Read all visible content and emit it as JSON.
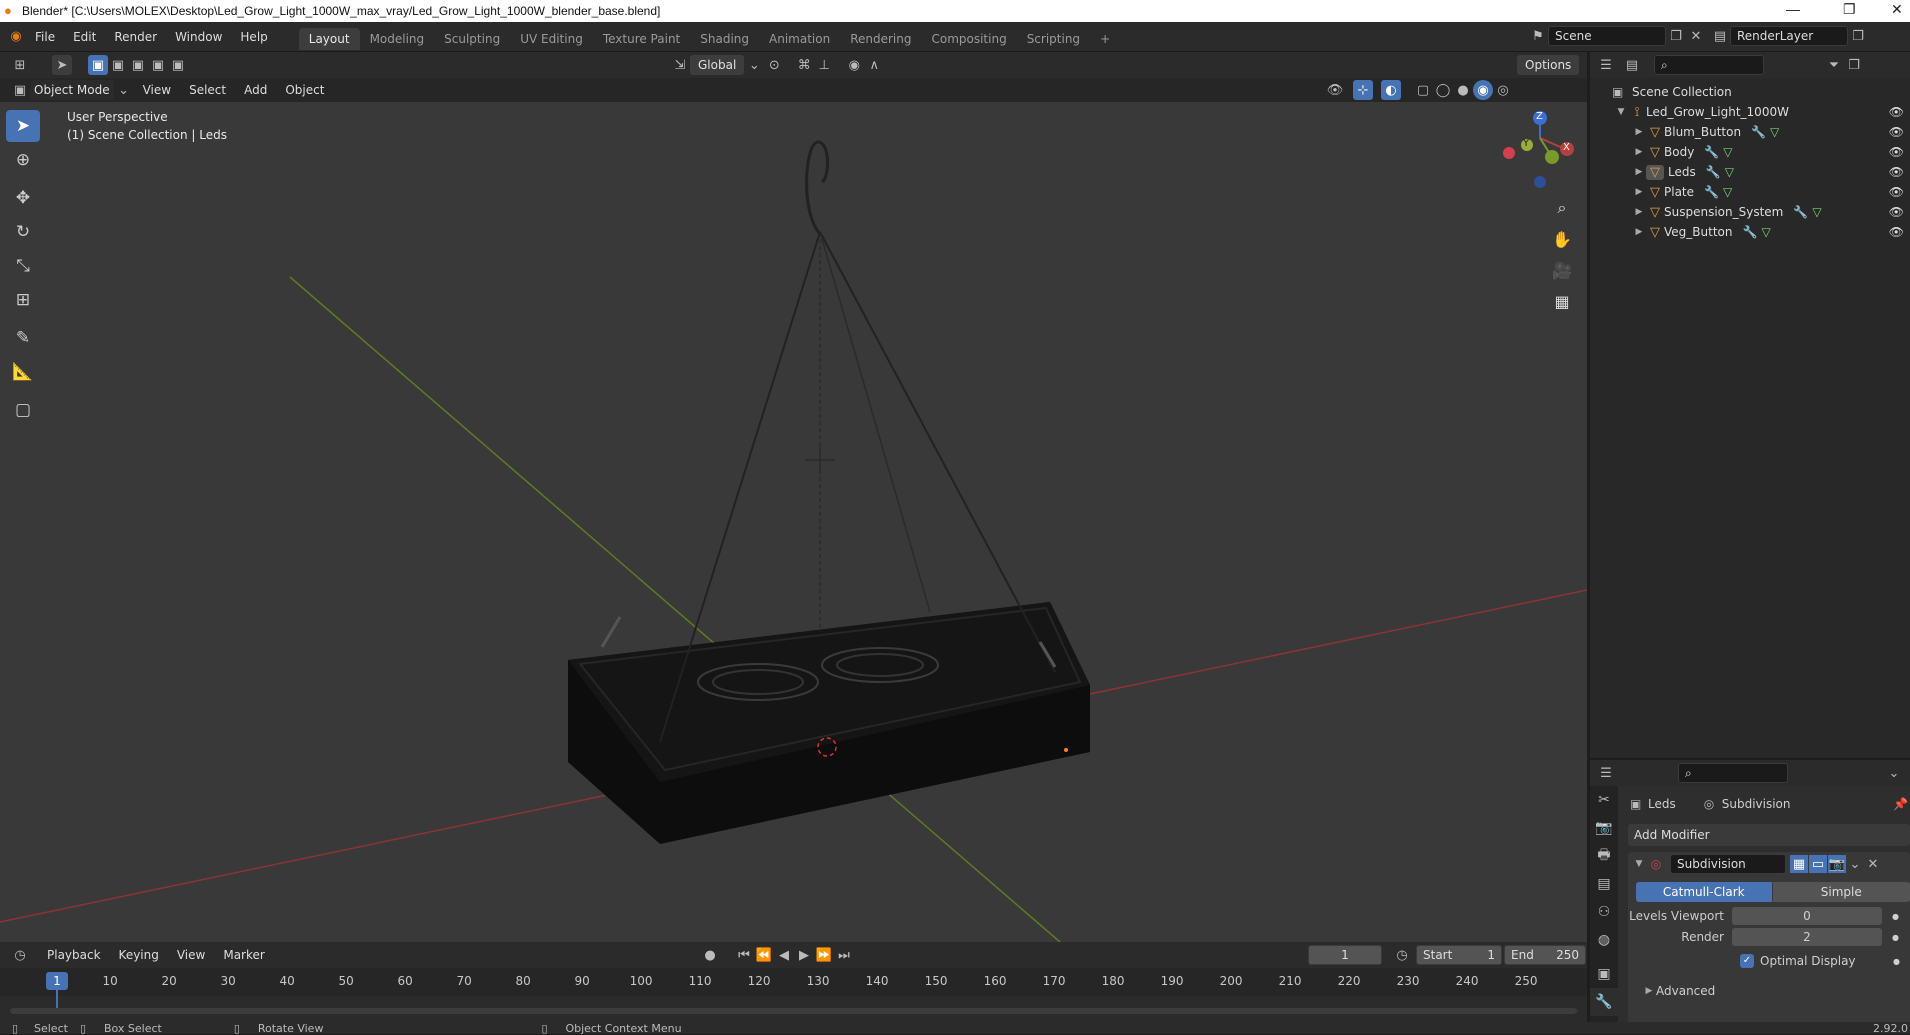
{
  "window": {
    "title": "Blender* [C:\\Users\\MOLEX\\Desktop\\Led_Grow_Light_1000W_max_vray/Led_Grow_Light_1000W_blender_base.blend]",
    "minimize": "—",
    "restore": "❐",
    "close": "✕"
  },
  "menu": [
    "File",
    "Edit",
    "Render",
    "Window",
    "Help"
  ],
  "workspaces": [
    {
      "label": "Layout",
      "active": true
    },
    {
      "label": "Modeling"
    },
    {
      "label": "Sculpting"
    },
    {
      "label": "UV Editing"
    },
    {
      "label": "Texture Paint"
    },
    {
      "label": "Shading"
    },
    {
      "label": "Animation"
    },
    {
      "label": "Rendering"
    },
    {
      "label": "Compositing"
    },
    {
      "label": "Scripting"
    }
  ],
  "workspace_add": "+",
  "scene": {
    "name": "Scene",
    "render_layer": "RenderLayer"
  },
  "viewport_header": {
    "transform_orientation": "Global",
    "options_label": "Options",
    "mode": "Object Mode",
    "menus": [
      "View",
      "Select",
      "Add",
      "Object"
    ]
  },
  "viewport": {
    "perspective": "User Perspective",
    "collection_info": "(1) Scene Collection | Leds",
    "gizmo": {
      "x": "X",
      "y": "Y",
      "z": "Z"
    }
  },
  "outliner": {
    "root": "Scene Collection",
    "collection": "Led_Grow_Light_1000W",
    "objects": [
      "Blum_Button",
      "Body",
      "Leds",
      "Plate",
      "Suspension_System",
      "Veg_Button"
    ]
  },
  "properties": {
    "object_name": "Leds",
    "modifier_name_header": "Subdivision",
    "add_modifier": "Add Modifier",
    "modifier": {
      "name": "Subdivision",
      "type_options": [
        "Catmull-Clark",
        "Simple"
      ],
      "selected_type": "Catmull-Clark",
      "levels_viewport_label": "Levels Viewport",
      "levels_viewport": "0",
      "render_label": "Render",
      "render": "2",
      "optimal_display_label": "Optimal Display",
      "optimal_display": true,
      "advanced_label": "Advanced"
    }
  },
  "timeline": {
    "menus": [
      "Playback",
      "Keying",
      "View",
      "Marker"
    ],
    "current_frame": "1",
    "start_label": "Start",
    "start": "1",
    "end_label": "End",
    "end": "250",
    "ticks": [
      "1",
      "10",
      "20",
      "30",
      "40",
      "50",
      "60",
      "70",
      "80",
      "90",
      "100",
      "110",
      "120",
      "130",
      "140",
      "150",
      "160",
      "170",
      "180",
      "190",
      "200",
      "210",
      "220",
      "230",
      "240",
      "250"
    ]
  },
  "statusbar": {
    "select": "Select",
    "box_select": "Box Select",
    "rotate_view": "Rotate View",
    "context_menu": "Object Context Menu",
    "version": "2.92.0"
  },
  "colors": {
    "accent": "#4772b3",
    "object_icon": "#e49b4a",
    "modifier_icon": "#6f9edb",
    "mesh_icon": "#7bd47b",
    "x_axis": "#b5403f",
    "y_axis": "#7a9a2e"
  }
}
